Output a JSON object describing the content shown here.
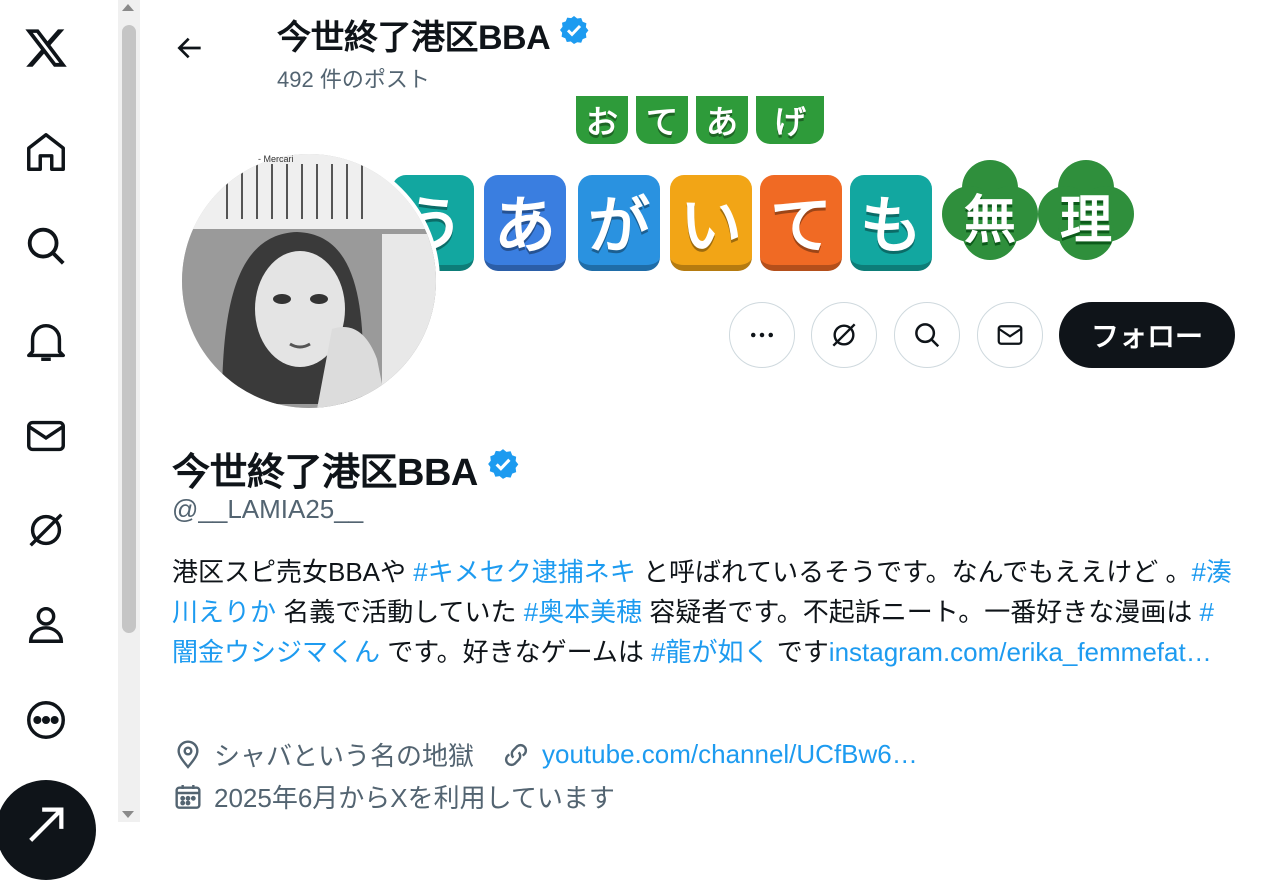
{
  "header": {
    "name": "今世終了港区BBA",
    "post_count": "492 件のポスト"
  },
  "banner": {
    "top_tiles": [
      "お",
      "て",
      "あ",
      "げ"
    ],
    "main_tiles": [
      "う",
      "あ",
      "が",
      "い",
      "て",
      "も"
    ],
    "clover_chars": [
      "無",
      "理"
    ]
  },
  "avatar": {
    "overlay_text": "- Mercari"
  },
  "actions": {
    "follow_label": "フォロー"
  },
  "profile": {
    "name": "今世終了港区BBA",
    "handle": "@__LAMIA25__",
    "bio": {
      "t1": "港区スピ売女BBAや ",
      "tag1": "#キメセク逮捕ネキ",
      "t2": " と呼ばれているそうです。なんでもええけど 。",
      "tag2": "#湊川えりか",
      "t3": " 名義で活動していた ",
      "tag3": "#奥本美穂",
      "t4": " 容疑者です。不起訴ニート。一番好きな漫画は ",
      "tag4": "#闇金ウシジマくん",
      "t5": " です。好きなゲームは ",
      "tag5": "#龍が如く",
      "t6": " です",
      "link": "instagram.com/erika_femmefat…"
    },
    "location": "シャバという名の地獄",
    "website": "youtube.com/channel/UCfBw6…",
    "joined": "2025年6月からXを利用しています"
  },
  "colors": {
    "accent": "#1d9bf0",
    "text": "#0f1419",
    "muted": "#536471",
    "border": "#cfd9de"
  },
  "icons": [
    "x-logo-icon",
    "home-icon",
    "search-icon",
    "bell-icon",
    "mail-icon",
    "grok-icon",
    "profile-icon",
    "more-icon",
    "post-icon",
    "back-arrow-icon",
    "verified-badge-icon",
    "ellipsis-icon",
    "grok-icon",
    "search-icon",
    "mail-icon",
    "location-icon",
    "link-icon",
    "calendar-icon"
  ]
}
